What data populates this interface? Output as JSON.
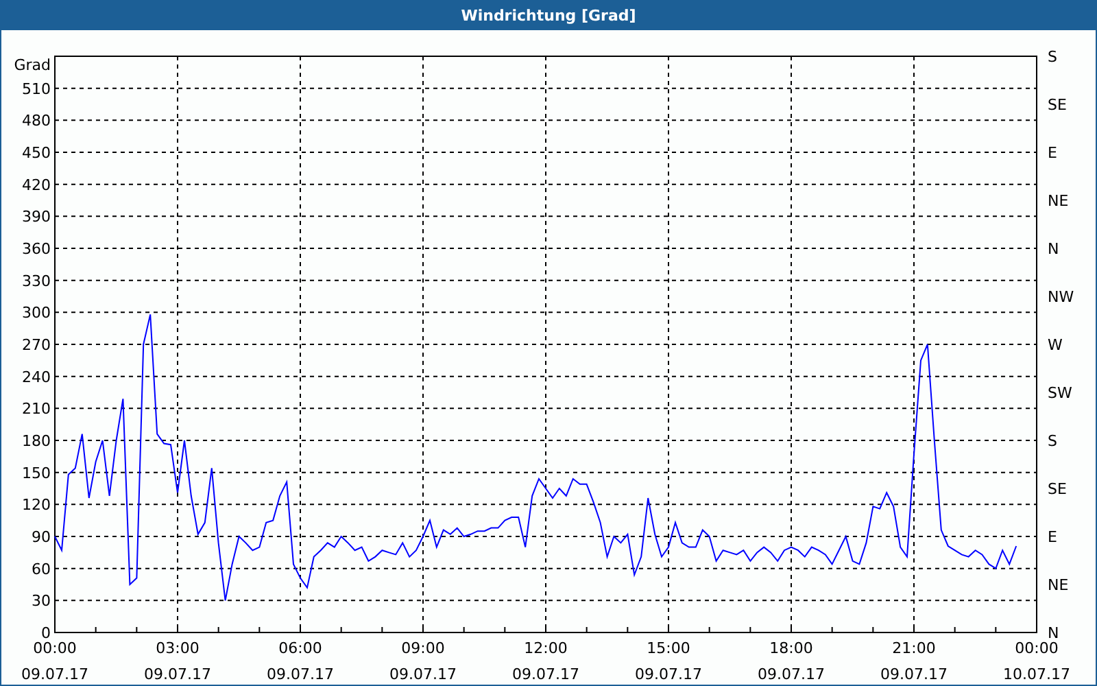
{
  "window": {
    "title": "Windrichtung [Grad]"
  },
  "chart": {
    "compass_labels": [
      "S",
      "SE",
      "E",
      "NE",
      "N",
      "NW",
      "W",
      "SW",
      "S",
      "SE",
      "E",
      "NE",
      "N"
    ],
    "chart_data": {
      "type": "line",
      "ylabel": "Grad",
      "grid": true,
      "ylim": [
        0,
        540
      ],
      "yticks": [
        0,
        30,
        60,
        90,
        120,
        150,
        180,
        210,
        240,
        270,
        300,
        330,
        360,
        390,
        420,
        450,
        480,
        510
      ],
      "categories": [
        "00:00\n09.07.17",
        null,
        null,
        null,
        null,
        null,
        null,
        null,
        null,
        null,
        null,
        null,
        null,
        null,
        null,
        null,
        null,
        null,
        "03:00\n09.07.17",
        null,
        null,
        null,
        null,
        null,
        null,
        null,
        null,
        null,
        null,
        null,
        null,
        null,
        null,
        null,
        null,
        null,
        "06:00\n09.07.17",
        null,
        null,
        null,
        null,
        null,
        null,
        null,
        null,
        null,
        null,
        null,
        null,
        null,
        null,
        null,
        null,
        null,
        "09:00\n09.07.17",
        null,
        null,
        null,
        null,
        null,
        null,
        null,
        null,
        null,
        null,
        null,
        null,
        null,
        null,
        null,
        null,
        null,
        "12:00\n09.07.17",
        null,
        null,
        null,
        null,
        null,
        null,
        null,
        null,
        null,
        null,
        null,
        null,
        null,
        null,
        null,
        null,
        null,
        "15:00\n09.07.17",
        null,
        null,
        null,
        null,
        null,
        null,
        null,
        null,
        null,
        null,
        null,
        null,
        null,
        null,
        null,
        null,
        null,
        "18:00\n09.07.17",
        null,
        null,
        null,
        null,
        null,
        null,
        null,
        null,
        null,
        null,
        null,
        null,
        null,
        null,
        null,
        null,
        null,
        "21:00\n09.07.17",
        null,
        null,
        null,
        null,
        null,
        null,
        null,
        null,
        null,
        null,
        null,
        null,
        null,
        null,
        null,
        null,
        null,
        "00:00\n10.07.17"
      ],
      "series": [
        {
          "color": "#0000ff",
          "values": [
            90,
            77,
            148,
            154,
            186,
            126,
            160,
            180,
            128,
            180,
            219,
            45,
            51,
            270,
            298,
            186,
            177,
            176,
            131,
            180,
            128,
            92,
            103,
            154,
            84,
            30,
            64,
            90,
            84,
            77,
            80,
            103,
            105,
            128,
            141,
            64,
            51,
            42,
            71,
            77,
            84,
            80,
            90,
            84,
            77,
            80,
            67,
            71,
            77,
            75,
            73,
            84,
            71,
            77,
            90,
            105,
            80,
            96,
            92,
            98,
            90,
            92,
            95,
            95,
            98,
            98,
            105,
            108,
            108,
            80,
            128,
            144,
            135,
            126,
            135,
            128,
            144,
            139,
            139,
            122,
            103,
            71,
            90,
            84,
            92,
            54,
            71,
            126,
            92,
            71,
            80,
            103,
            84,
            80,
            80,
            96,
            90,
            67,
            77,
            75,
            73,
            77,
            67,
            75,
            80,
            75,
            67,
            77,
            80,
            77,
            71,
            80,
            77,
            73,
            64,
            77,
            90,
            67,
            64,
            84,
            118,
            116,
            131,
            118,
            80,
            71,
            167,
            255,
            270,
            180,
            96,
            81,
            77,
            73,
            71,
            77,
            73,
            64,
            60,
            77,
            64,
            81,
            null,
            null,
            null
          ]
        }
      ]
    }
  }
}
